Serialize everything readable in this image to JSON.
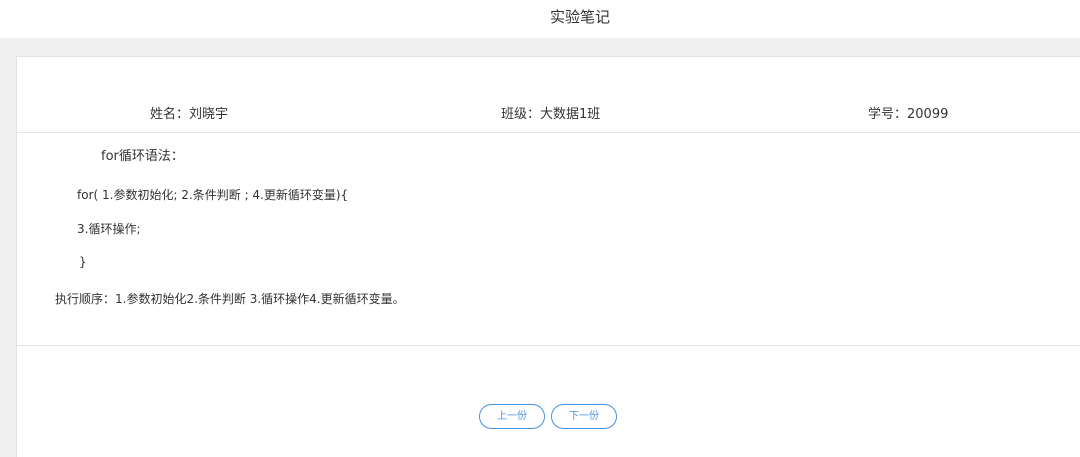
{
  "header": {
    "title": "实验笔记"
  },
  "info": {
    "name": "姓名：刘晓宇",
    "class": "班级：大数据1班",
    "student_id": "学号：20099"
  },
  "note": {
    "lines": [
      "for循环语法：",
      "for( 1.参数初始化; 2.条件判断 ; 4.更新循环变量){",
      "3.循环操作;",
      "}",
      "执行顺序：1.参数初始化2.条件判断 3.循环操作4.更新循环变量。"
    ]
  },
  "pager": {
    "prev_label": "上一份",
    "next_label": "下一份"
  },
  "colors": {
    "accent": "#4a90e2",
    "band": "#f0f0f0"
  }
}
